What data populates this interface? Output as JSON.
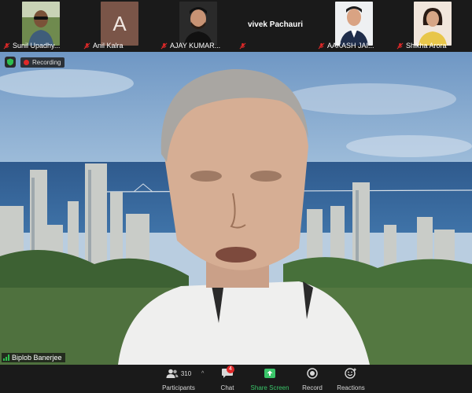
{
  "participants": [
    {
      "name": "Sunil Upadhy..."
    },
    {
      "name": "Anil Kalra",
      "avatar_letter": "A"
    },
    {
      "name": "AJAY KUMAR..."
    },
    {
      "name": "vivek Pachauri"
    },
    {
      "name": "AAKASH JAI..."
    },
    {
      "name": "Shikha Arora"
    }
  ],
  "recording": {
    "label": "Recording"
  },
  "speaker": {
    "name": "Biplob Banerjee"
  },
  "toolbar": {
    "participants_label": "Participants",
    "participants_count": "310",
    "chat_label": "Chat",
    "chat_badge": "4",
    "share_label": "Share Screen",
    "record_label": "Record",
    "reactions_label": "Reactions"
  },
  "colors": {
    "toolbar_bg": "#1a1a1a",
    "share_green": "#3ac569",
    "alert_red": "#e02828",
    "audio_green": "#2dbe4e"
  }
}
